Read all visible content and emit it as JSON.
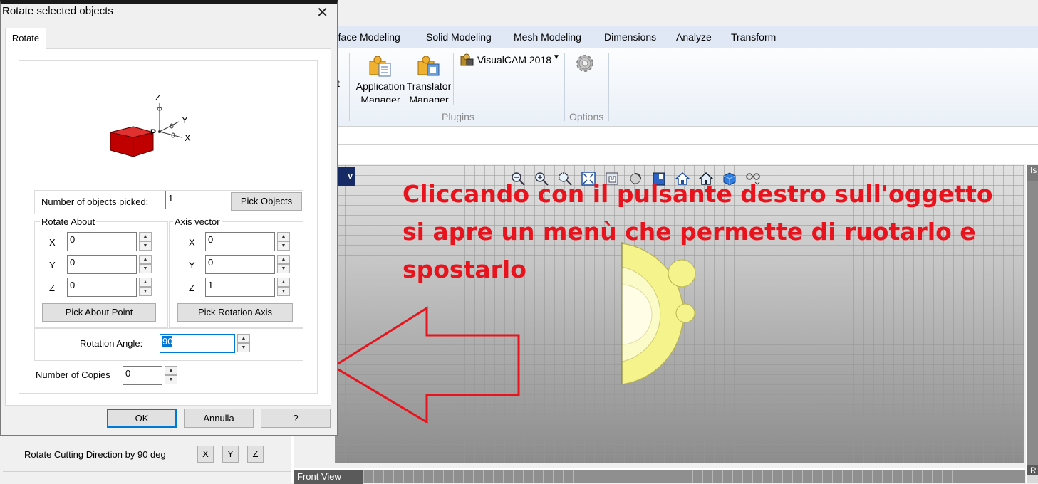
{
  "ribbon": {
    "tabs": [
      "rface Modeling",
      "Solid Modeling",
      "Mesh Modeling",
      "Dimensions",
      "Analyze",
      "Transform"
    ],
    "truncated_label": "t",
    "application_manager": [
      "Application",
      "Manager"
    ],
    "translator_manager": [
      "Translator",
      "Manager"
    ],
    "visualcam_label": "VisualCAM 2018",
    "groups": {
      "plugins": "Plugins",
      "options": "Options"
    }
  },
  "viewport": {
    "corner_tab": "v",
    "annotation": "Cliccando con il pulsante destro sull'oggetto si apre un menù che permette di ruotarlo e spostarlo",
    "front_view_label": "Front View",
    "right_panel_top": "Is",
    "right_panel_bottom": "R"
  },
  "bottom_panel": {
    "label": "Rotate Cutting Direction by 90 deg",
    "buttons": [
      "X",
      "Y",
      "Z"
    ]
  },
  "dialog": {
    "title": "Rotate selected objects",
    "close": "✕",
    "tab": "Rotate",
    "diagram_labels": {
      "z": "Z",
      "y": "Y",
      "x": "X",
      "p": "P"
    },
    "objects_picked_label": "Number of objects picked:",
    "objects_picked_value": "1",
    "pick_objects": "Pick Objects",
    "rotate_about": {
      "title": "Rotate About",
      "x_label": "X",
      "x_value": "0",
      "y_label": "Y",
      "y_value": "0",
      "z_label": "Z",
      "z_value": "0",
      "button": "Pick About Point"
    },
    "axis_vector": {
      "title": "Axis vector",
      "x_label": "X",
      "x_value": "0",
      "y_label": "Y",
      "y_value": "0",
      "z_label": "Z",
      "z_value": "1",
      "button": "Pick Rotation Axis"
    },
    "rotation_angle_label": "Rotation Angle:",
    "rotation_angle_value": "90",
    "copies_label": "Number of Copies",
    "copies_value": "0",
    "ok": "OK",
    "cancel": "Annulla",
    "help": "?"
  },
  "colors": {
    "annotation": "#e8131c",
    "accent": "#0078d7",
    "model": "#f7f7a0",
    "box": "#cc0000"
  }
}
